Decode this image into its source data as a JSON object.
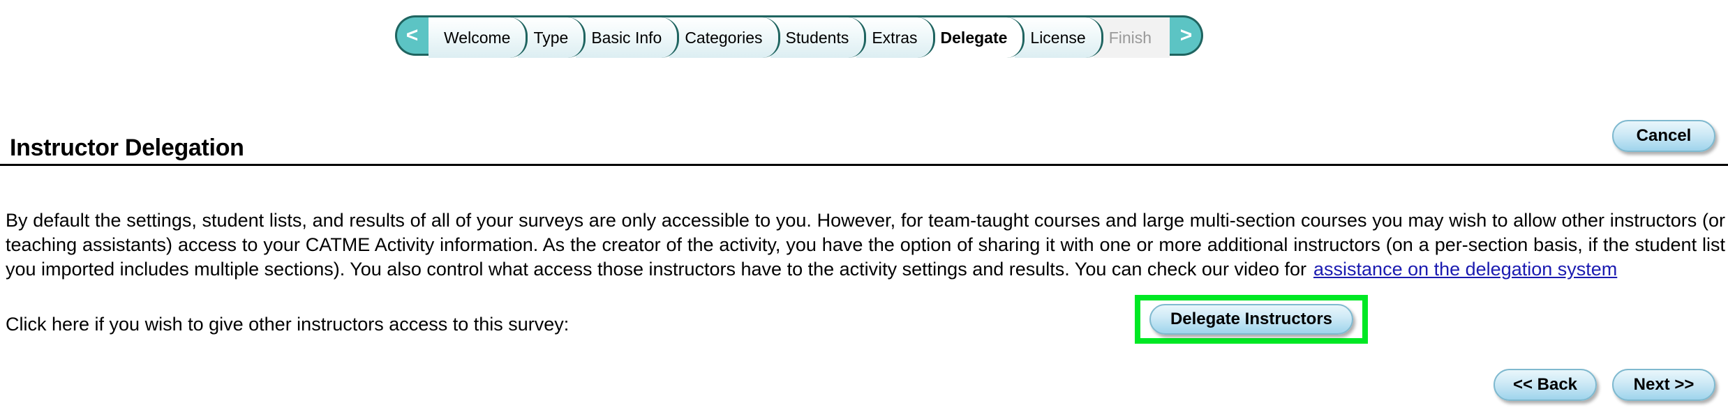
{
  "wizard": {
    "prev_arrow": "<",
    "next_arrow": ">",
    "prev_arrow_name": "chevron-left-icon",
    "next_arrow_name": "chevron-right-icon",
    "steps": [
      {
        "label": "Welcome",
        "state": "visited"
      },
      {
        "label": "Type",
        "state": "visited"
      },
      {
        "label": "Basic Info",
        "state": "visited"
      },
      {
        "label": "Categories",
        "state": "visited"
      },
      {
        "label": "Students",
        "state": "visited"
      },
      {
        "label": "Extras",
        "state": "visited"
      },
      {
        "label": "Delegate",
        "state": "active"
      },
      {
        "label": "License",
        "state": "visited"
      },
      {
        "label": "Finish",
        "state": "disabled"
      }
    ],
    "accent_color": "#5cc4c4",
    "outline_color": "#1f6460"
  },
  "header": {
    "title": "Instructor Delegation",
    "cancel_label": "Cancel"
  },
  "body": {
    "paragraph": "By default the settings, student lists, and results of all of your surveys are only accessible to you. However, for team-taught courses and large multi-section courses you may wish to allow other instructors (or teaching assistants) access to your CATME Activity information. As the creator of the activity, you have the option of sharing it with one or more additional instructors (on a per-section basis, if the student list you imported includes multiple sections). You also control what access those instructors have to the activity settings and results. You can check our video for",
    "link_label": "assistance on the delegation system",
    "link_color": "#1a1ab0",
    "click_here_text": "Click here if you wish to give other instructors access to this survey:",
    "delegate_button_label": "Delegate Instructors",
    "highlight_color": "#00e824"
  },
  "footer": {
    "back_label": "<< Back",
    "next_label": "Next >>"
  }
}
